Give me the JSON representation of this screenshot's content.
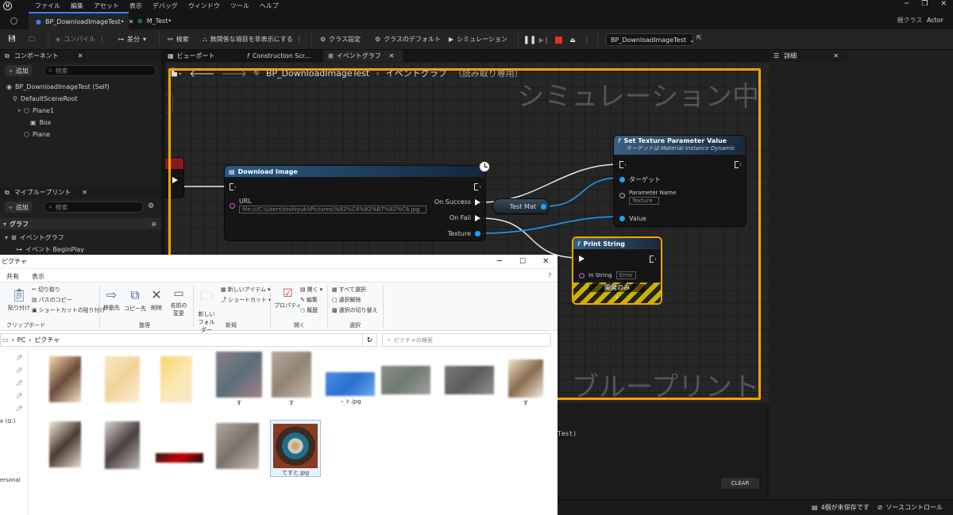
{
  "menu": [
    "ファイル",
    "編集",
    "アセット",
    "表示",
    "デバッグ",
    "ウィンドウ",
    "ツール",
    "ヘルプ"
  ],
  "parent_class": {
    "label": "親クラス",
    "value": "Actor"
  },
  "doc_tabs": [
    {
      "label": "BP_DownloadImageTest•"
    },
    {
      "label": "M_Test•"
    }
  ],
  "toolbar": {
    "compile": "コンパイル",
    "diff": "差分",
    "find": "検索",
    "hide_unrelated": "無関係な項目を非表示にする",
    "class_settings": "クラス設定",
    "class_defaults": "クラスのデフォルト",
    "simulation": "シミュレーション",
    "debug_object": "BP_DownloadImageTest"
  },
  "components": {
    "title": "コンポーネント",
    "add": "追加",
    "search_placeholder": "検索",
    "tree": [
      {
        "label": "BP_DownloadImageTest (Self)"
      },
      {
        "label": "DefaultSceneRoot"
      },
      {
        "label": "Plane1"
      },
      {
        "label": "Box"
      },
      {
        "label": "Plane"
      }
    ]
  },
  "my_blueprint": {
    "title": "マイブループリント",
    "add": "追加",
    "search_placeholder": "検索",
    "graph_section": "グラフ",
    "event_graph": "イベントグラフ",
    "event_begin_play": "イベント BeginPlay"
  },
  "graph_tabs": [
    "ビューポート",
    "Construction Scr...",
    "イベントグラフ"
  ],
  "details": {
    "title": "詳細"
  },
  "breadcrumb": {
    "blueprint": "BP_DownloadImageTest",
    "graph": "イベントグラフ",
    "mode": "（読み取り専用）"
  },
  "watermarks": {
    "simulating": "シミュレーション中",
    "blueprint": "ブループリント"
  },
  "nodes": {
    "download": {
      "title": "Download Image",
      "url_label": "URL",
      "url_value": "file:///C:\\Users\\toshiyuki\\Pictures\\%82%C4%82%B7%82%C6.jpg",
      "on_success": "On Success",
      "on_fail": "On Fail",
      "texture": "Texture"
    },
    "test_mat": {
      "label": "Test Mat"
    },
    "set_texture": {
      "title": "Set Texture Parameter Value",
      "subtitle": "ターゲットは Material Instance Dynamic",
      "target": "ターゲット",
      "param_name": "Parameter Name",
      "param_value": "Texture",
      "value": "Value"
    },
    "print_string": {
      "title": "Print String",
      "in_string": "In String",
      "in_string_value": "Error",
      "dev_only": "開発のみ"
    }
  },
  "explorer": {
    "title": "ピクチャ",
    "tabs": [
      "共有",
      "表示"
    ],
    "ribbon": {
      "cut": "切り取り",
      "copy_path": "パスのコピー",
      "paste": "貼り付け",
      "paste_shortcut": "ショートカットの貼り付け",
      "move_to": "移動先",
      "copy_to": "コピー先",
      "delete": "削除",
      "rename": "名前の変更",
      "new_folder": "新しいフォルダー",
      "new_item": "新しいアイテム",
      "easy_access": "ショートカット",
      "properties": "プロパティ",
      "open": "開く",
      "edit": "編集",
      "history": "履歴",
      "select_all": "すべて選択",
      "select_none": "選択解除",
      "invert": "選択の切り替え",
      "groups": [
        "クリップボード",
        "整理",
        "新規",
        "開く",
        "選択"
      ]
    },
    "path": [
      "PC",
      "ピクチャ"
    ],
    "search_placeholder": "ピクチャの検索",
    "sidebar": [
      "e (G:)",
      "ersonal"
    ],
    "files": [
      {
        "name": ""
      },
      {
        "name": ""
      },
      {
        "name": ""
      },
      {
        "name": "す"
      },
      {
        "name": "す"
      },
      {
        "name": "・ト.jpg"
      },
      {
        "name": ""
      },
      {
        "name": ""
      },
      {
        "name": "す"
      },
      {
        "name": ""
      },
      {
        "name": ""
      },
      {
        "name": ""
      },
      {
        "name": ""
      },
      {
        "name": "てすと.jpg"
      }
    ]
  },
  "log": {
    "text": "Test)",
    "clear": "CLEAR"
  },
  "status": {
    "unsaved": "4個が未保存です",
    "source_control": "ソースコントロール"
  }
}
